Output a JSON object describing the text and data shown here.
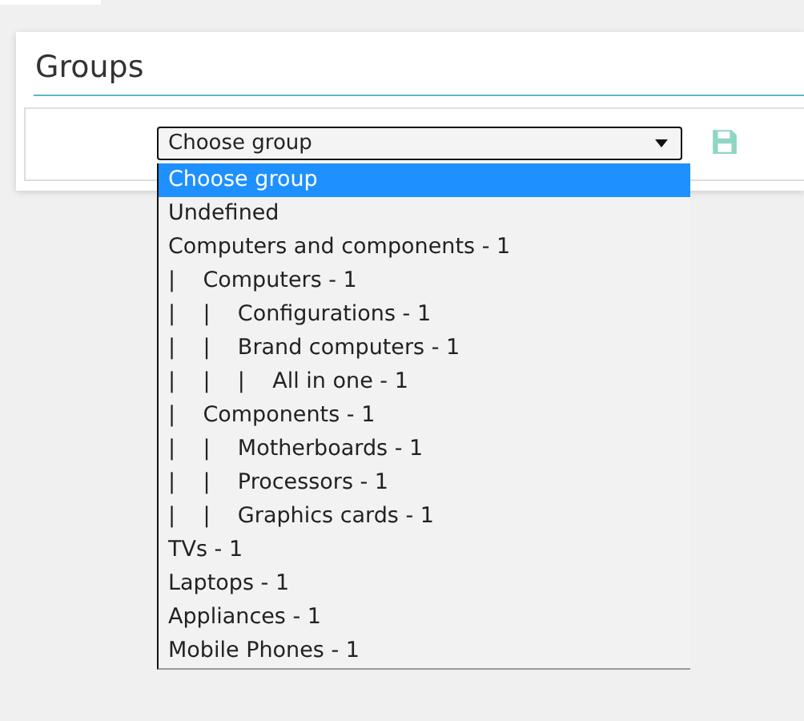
{
  "panel": {
    "title": "Groups"
  },
  "group_select": {
    "value": "Choose group",
    "options": [
      {
        "label": "Choose group",
        "selected": true
      },
      {
        "label": "Undefined",
        "selected": false
      },
      {
        "label": "Computers and components - 1",
        "selected": false
      },
      {
        "label": "|    Computers - 1",
        "selected": false
      },
      {
        "label": "|    |    Configurations - 1",
        "selected": false
      },
      {
        "label": "|    |    Brand computers - 1",
        "selected": false
      },
      {
        "label": "|    |    |    All in one - 1",
        "selected": false
      },
      {
        "label": "|    Components - 1",
        "selected": false
      },
      {
        "label": "|    |    Motherboards - 1",
        "selected": false
      },
      {
        "label": "|    |    Processors - 1",
        "selected": false
      },
      {
        "label": "|    |    Graphics cards - 1",
        "selected": false
      },
      {
        "label": "TVs - 1",
        "selected": false
      },
      {
        "label": "Laptops - 1",
        "selected": false
      },
      {
        "label": "Appliances - 1",
        "selected": false
      },
      {
        "label": "Mobile Phones - 1",
        "selected": false
      }
    ]
  }
}
